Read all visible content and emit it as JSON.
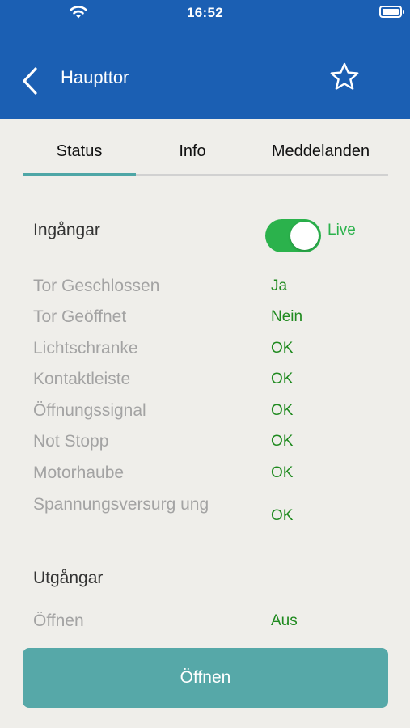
{
  "status_bar": {
    "time": "16:52"
  },
  "header": {
    "title": "Haupttor"
  },
  "tabs": [
    {
      "label": "Status"
    },
    {
      "label": "Info"
    },
    {
      "label": "Meddelanden"
    }
  ],
  "inputs": {
    "title": "Ingångar",
    "live_label": "Live",
    "live_enabled": true,
    "rows": [
      {
        "label": "Tor Geschlossen",
        "value": "Ja"
      },
      {
        "label": "Tor Geöffnet",
        "value": "Nein"
      },
      {
        "label": "Lichtschranke",
        "value": "OK"
      },
      {
        "label": "Kontaktleiste",
        "value": "OK"
      },
      {
        "label": "Öffnungssignal",
        "value": "OK"
      },
      {
        "label": "Not Stopp",
        "value": "OK"
      },
      {
        "label": "Motorhaube",
        "value": "OK"
      },
      {
        "label": "Spannungsversurg ung",
        "value": "OK"
      }
    ]
  },
  "outputs": {
    "title": "Utgångar",
    "rows": [
      {
        "label": "Öffnen",
        "value": "Aus"
      }
    ]
  },
  "action_button": {
    "label": "Öffnen"
  },
  "colors": {
    "header": "#1b5fb3",
    "accent": "#56a8a8",
    "toggle_on": "#2bb24c",
    "value_green": "#1f8a1f"
  }
}
